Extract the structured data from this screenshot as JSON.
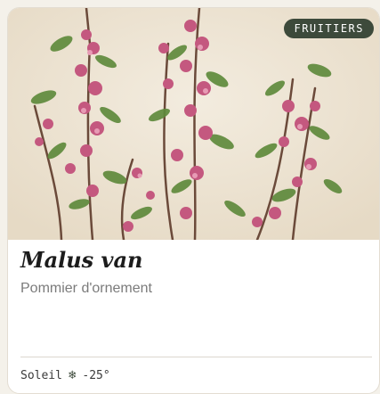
{
  "card": {
    "badge": "FRUITIERS",
    "image_alt": "Malus van flowering branches",
    "title": "Malus van",
    "subtitle": "Pommier d'ornement",
    "exposure": "Soleil",
    "hardiness_icon": "snowflake-icon",
    "hardiness": "-25°"
  },
  "colors": {
    "badge_bg": "#3d4a3b",
    "photo_bg": "#efe6d6",
    "blossom": "#c4587f",
    "leaf": "#5f8a3c"
  }
}
